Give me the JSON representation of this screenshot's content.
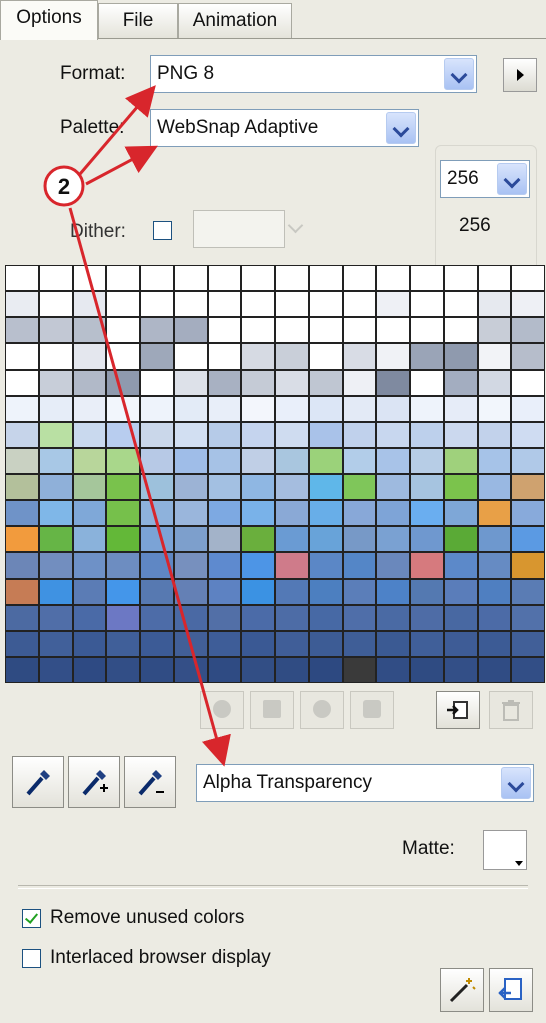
{
  "tabs": [
    {
      "label": "Options",
      "active": true
    },
    {
      "label": "File",
      "active": false
    },
    {
      "label": "Animation",
      "active": false
    }
  ],
  "format": {
    "label": "Format:",
    "value": "PNG 8"
  },
  "palette": {
    "label": "Palette:",
    "value": "WebSnap Adaptive"
  },
  "colors": {
    "max_value": "256",
    "count": "256"
  },
  "dither": {
    "label": "Dither:",
    "checked": false
  },
  "transparency": {
    "value": "Alpha Transparency"
  },
  "matte": {
    "label": "Matte:"
  },
  "options": {
    "remove_unused": {
      "label": "Remove unused colors",
      "checked": true
    },
    "interlaced": {
      "label": "Interlaced browser display",
      "checked": false
    }
  },
  "callout": {
    "number": "2",
    "color": "#d8262c"
  },
  "palette_rows": [
    [
      "#ffffff",
      "#ffffff",
      "#ffffff",
      "#ffffff",
      "#ffffff",
      "#ffffff",
      "#ffffff",
      "#ffffff",
      "#ffffff",
      "#ffffff",
      "#ffffff",
      "#ffffff",
      "#ffffff",
      "#ffffff",
      "#ffffff",
      "#ffffff"
    ],
    [
      "#e9ecf2",
      "#ffffff",
      "#e6e9f0",
      "#ffffff",
      "#ffffff",
      "#ffffff",
      "#ffffff",
      "#ffffff",
      "#ffffff",
      "#ffffff",
      "#ffffff",
      "#eef0f5",
      "#ffffff",
      "#ffffff",
      "#e6e9ef",
      "#eef0f5"
    ],
    [
      "#b8bfcd",
      "#c2c8d4",
      "#b7bfcc",
      "#ffffff",
      "#aeb6c6",
      "#a4adbf",
      "#ffffff",
      "#ffffff",
      "#ffffff",
      "#ffffff",
      "#ffffff",
      "#ffffff",
      "#ffffff",
      "#ffffff",
      "#c8cdd7",
      "#b3bbca"
    ],
    [
      "#ffffff",
      "#ffffff",
      "#e4e7ee",
      "#ffffff",
      "#9ea8ba",
      "#ffffff",
      "#ffffff",
      "#d6dae3",
      "#c9cfd9",
      "#ffffff",
      "#d8dce5",
      "#f0f2f6",
      "#9aa4b7",
      "#8f9aae",
      "#f2f3f7",
      "#b6bdcb"
    ],
    [
      "#ffffff",
      "#c8ced9",
      "#b1b9c8",
      "#8f9aae",
      "#ffffff",
      "#dde1e9",
      "#a8b1c2",
      "#c5cbd6",
      "#d9dde6",
      "#bfc6d2",
      "#eef0f5",
      "#7f8aa0",
      "#ffffff",
      "#a3adc0",
      "#d2d8e3",
      "#ffffff"
    ],
    [
      "#eef3fb",
      "#e6edf8",
      "#e9eef8",
      "#f2f6fc",
      "#eef3fb",
      "#e3ebf7",
      "#e8eef9",
      "#f3f6fc",
      "#e9effa",
      "#dce6f6",
      "#e3eaf6",
      "#dbe4f4",
      "#eef3fb",
      "#e6ecf8",
      "#f2f6fc",
      "#e9effa"
    ],
    [
      "#c6d4ea",
      "#b9e0a3",
      "#c9d9ee",
      "#b8cdef",
      "#cad7ea",
      "#d2dff2",
      "#b6cbe8",
      "#c5d4ee",
      "#cfdcf0",
      "#a9c2e9",
      "#c0d1ec",
      "#c8d7ef",
      "#bdd0ec",
      "#cbd8ee",
      "#c2d2eb",
      "#cfdcf2"
    ],
    [
      "#c9d1c2",
      "#a8c8e6",
      "#b8d69b",
      "#a9d78b",
      "#b7c9e6",
      "#9fbde8",
      "#a6c2e6",
      "#c0cfe6",
      "#a9c6df",
      "#9bd27a",
      "#b2cde9",
      "#a8c3e8",
      "#b7cde6",
      "#9fd17c",
      "#a6c3e8",
      "#b0c9e8"
    ],
    [
      "#b3c09b",
      "#8fb0d9",
      "#a5c69b",
      "#79c24c",
      "#9dc1dc",
      "#9cb3d5",
      "#a3c0e2",
      "#8fb7e3",
      "#a5bddf",
      "#5fb7e9",
      "#7fc65a",
      "#9ebadf",
      "#a6c4e0",
      "#7bc34c",
      "#99b8e2",
      "#cfa26f"
    ],
    [
      "#6f93c8",
      "#7fb7e8",
      "#7fa8d8",
      "#76c04b",
      "#8eb2dc",
      "#9ab6dc",
      "#7da9e2",
      "#79b2e9",
      "#8aa9d6",
      "#68aee8",
      "#88a8d8",
      "#7ea4d7",
      "#6aaef0",
      "#7ea7d7",
      "#e8a047",
      "#88aadb"
    ],
    [
      "#f29b3d",
      "#66b546",
      "#8ab2db",
      "#63b838",
      "#7ba3d6",
      "#7d9fcc",
      "#a3b3c9",
      "#6aaf3d",
      "#6a9bd3",
      "#68a3d9",
      "#7799c7",
      "#7aa1d2",
      "#6f98cf",
      "#5aaa36",
      "#6e98ce",
      "#5b9ae3"
    ],
    [
      "#6c86b7",
      "#728ebf",
      "#6e91c7",
      "#6d8dc1",
      "#5f87c4",
      "#7790be",
      "#5e8acf",
      "#4d95e6",
      "#cf7b8a",
      "#5b87c6",
      "#5486c7",
      "#6a88bc",
      "#d67a7e",
      "#5c89c9",
      "#668bc3",
      "#d8962f"
    ],
    [
      "#c67c55",
      "#3f92e2",
      "#5b7cb5",
      "#4496ea",
      "#5779b1",
      "#6480b5",
      "#5d82c2",
      "#3b92e3",
      "#5379b6",
      "#4c7fc0",
      "#5b7eb9",
      "#4d82c8",
      "#5479b1",
      "#5a7dba",
      "#4f7fc1",
      "#5a7cb4"
    ],
    [
      "#4c6aa2",
      "#506ea8",
      "#4a6aa7",
      "#6c78c4",
      "#4d6ca8",
      "#4a69a4",
      "#526fa7",
      "#4b6ba8",
      "#4d6ca6",
      "#4769a5",
      "#4f6ea9",
      "#4a6aa4",
      "#4e6ca6",
      "#4868a2",
      "#4c6ba7",
      "#5271aa"
    ],
    [
      "#3d5b94",
      "#41609a",
      "#3b5a95",
      "#405f99",
      "#3c5b96",
      "#425f97",
      "#3e5d98",
      "#3a5994",
      "#405e98",
      "#3d5c95",
      "#3f5e97",
      "#3b5a93",
      "#405f99",
      "#3e5c96",
      "#3c5b95",
      "#415f98"
    ],
    [
      "#2f4b82",
      "#334f88",
      "#2e4a83",
      "#324e86",
      "#304c84",
      "#344f87",
      "#2f4b83",
      "#324e85",
      "#304c83",
      "#2d4981",
      "#3a3a3a",
      "#314d85",
      "#2f4b82",
      "#334f87",
      "#304c84",
      "#324e86"
    ]
  ]
}
